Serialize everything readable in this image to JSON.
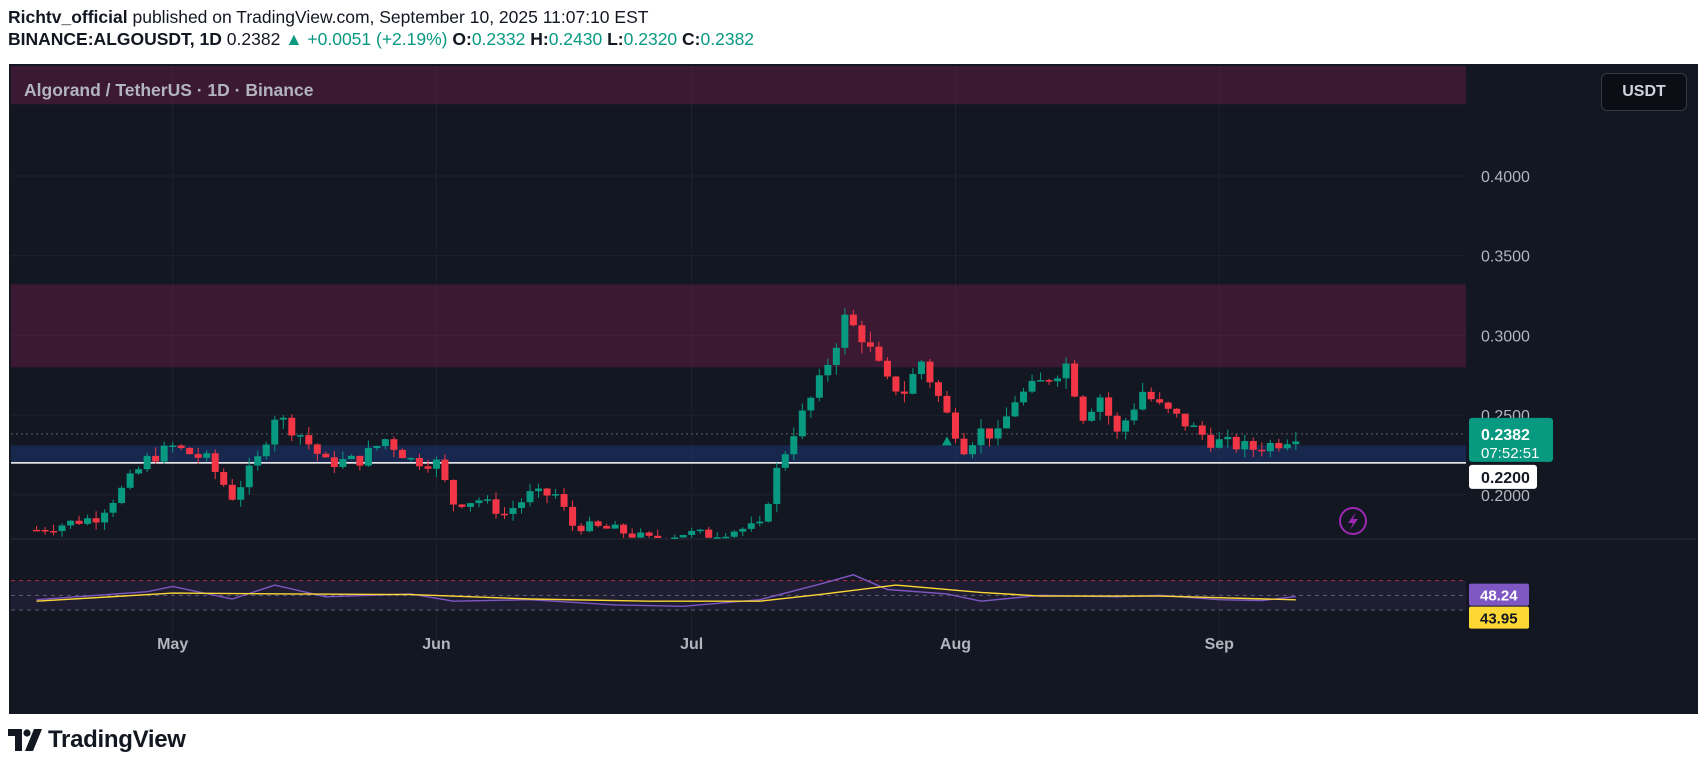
{
  "header": {
    "author": "Richtv_official",
    "published_text": " published on TradingView.com, September 10, 2025 11:07:10 EST",
    "symbol": "BINANCE:ALGOUSDT, 1D",
    "last": "0.2382",
    "change": "+0.0051 (+2.19%)",
    "o_label": "O:",
    "o": "0.2332",
    "h_label": "H:",
    "h": "0.2430",
    "l_label": "L:",
    "l": "0.2320",
    "c_label": "C:",
    "c": "0.2382"
  },
  "chart_header": {
    "title": "Algorand / TetherUS · 1D · Binance",
    "currency": "USDT"
  },
  "footer": {
    "brand": "TradingView"
  },
  "colors": {
    "up": "#089981",
    "down": "#f23645",
    "background": "#131722",
    "rsi_line": "#7e57c2",
    "rsi_ma": "#fdd835",
    "support_zone": "#1e3a8a",
    "resistance_zone": "#5b1f3c"
  },
  "chart_data": {
    "type": "candlestick",
    "title": "Algorand / TetherUS · 1D · Binance",
    "x_labels": [
      "May",
      "Jun",
      "Jul",
      "Aug",
      "Sep"
    ],
    "y_ticks": [
      "0.4000",
      "0.3500",
      "0.3000",
      "0.2500",
      "0.2000"
    ],
    "ylim": [
      0.17,
      0.45
    ],
    "current_price_label": "0.2382",
    "countdown_label": "07:52:51",
    "line_label": "0.2200",
    "zones": [
      {
        "type": "resistance",
        "from": 0.28,
        "to": 0.332
      },
      {
        "type": "resistance",
        "from": 0.445,
        "to": 0.47
      },
      {
        "type": "support",
        "from": 0.22,
        "to": 0.231
      }
    ],
    "horizontal_line": 0.22,
    "trend": [
      [
        "2025-04-15",
        0.178
      ],
      [
        "2025-04-22",
        0.186
      ],
      [
        "2025-04-25",
        0.203
      ],
      [
        "2025-04-28",
        0.222
      ],
      [
        "2025-05-01",
        0.23
      ],
      [
        "2025-05-05",
        0.222
      ],
      [
        "2025-05-08",
        0.199
      ],
      [
        "2025-05-11",
        0.222
      ],
      [
        "2025-05-13",
        0.25
      ],
      [
        "2025-05-16",
        0.238
      ],
      [
        "2025-05-19",
        0.22
      ],
      [
        "2025-05-23",
        0.222
      ],
      [
        "2025-05-26",
        0.235
      ],
      [
        "2025-05-29",
        0.222
      ],
      [
        "2025-06-01",
        0.22
      ],
      [
        "2025-06-03",
        0.195
      ],
      [
        "2025-06-06",
        0.197
      ],
      [
        "2025-06-09",
        0.188
      ],
      [
        "2025-06-12",
        0.2
      ],
      [
        "2025-06-15",
        0.2
      ],
      [
        "2025-06-17",
        0.181
      ],
      [
        "2025-06-22",
        0.178
      ],
      [
        "2025-06-26",
        0.172
      ],
      [
        "2025-06-30",
        0.176
      ],
      [
        "2025-07-03",
        0.175
      ],
      [
        "2025-07-06",
        0.178
      ],
      [
        "2025-07-09",
        0.18
      ],
      [
        "2025-07-11",
        0.215
      ],
      [
        "2025-07-13",
        0.24
      ],
      [
        "2025-07-16",
        0.27
      ],
      [
        "2025-07-19",
        0.31
      ],
      [
        "2025-07-21",
        0.3
      ],
      [
        "2025-07-24",
        0.27
      ],
      [
        "2025-07-26",
        0.265
      ],
      [
        "2025-07-28",
        0.284
      ],
      [
        "2025-07-31",
        0.25
      ],
      [
        "2025-08-02",
        0.23
      ],
      [
        "2025-08-04",
        0.24
      ],
      [
        "2025-08-06",
        0.237
      ],
      [
        "2025-08-08",
        0.26
      ],
      [
        "2025-08-11",
        0.27
      ],
      [
        "2025-08-14",
        0.282
      ],
      [
        "2025-08-16",
        0.25
      ],
      [
        "2025-08-18",
        0.262
      ],
      [
        "2025-08-20",
        0.238
      ],
      [
        "2025-08-23",
        0.265
      ],
      [
        "2025-08-25",
        0.255
      ],
      [
        "2025-08-28",
        0.245
      ],
      [
        "2025-08-31",
        0.234
      ],
      [
        "2025-09-02",
        0.232
      ],
      [
        "2025-09-05",
        0.229
      ],
      [
        "2025-09-08",
        0.233
      ],
      [
        "2025-09-10",
        0.2382
      ]
    ],
    "rsi": {
      "value_label": "48.24",
      "ma_label": "43.95",
      "upper": 70,
      "lower": 30,
      "trend": [
        [
          "2025-04-15",
          44
        ],
        [
          "2025-04-28",
          55
        ],
        [
          "2025-05-01",
          62
        ],
        [
          "2025-05-08",
          45
        ],
        [
          "2025-05-13",
          64
        ],
        [
          "2025-05-19",
          48
        ],
        [
          "2025-05-29",
          52
        ],
        [
          "2025-06-03",
          42
        ],
        [
          "2025-06-12",
          44
        ],
        [
          "2025-06-22",
          37
        ],
        [
          "2025-06-30",
          35
        ],
        [
          "2025-07-09",
          44
        ],
        [
          "2025-07-16",
          65
        ],
        [
          "2025-07-20",
          78
        ],
        [
          "2025-07-24",
          58
        ],
        [
          "2025-07-31",
          52
        ],
        [
          "2025-08-04",
          42
        ],
        [
          "2025-08-11",
          50
        ],
        [
          "2025-08-20",
          48
        ],
        [
          "2025-08-25",
          50
        ],
        [
          "2025-09-01",
          44
        ],
        [
          "2025-09-06",
          43
        ],
        [
          "2025-09-10",
          48.24
        ]
      ],
      "ma_trend": [
        [
          "2025-04-15",
          42
        ],
        [
          "2025-05-01",
          53
        ],
        [
          "2025-05-15",
          52
        ],
        [
          "2025-05-29",
          51
        ],
        [
          "2025-06-12",
          45
        ],
        [
          "2025-06-26",
          42
        ],
        [
          "2025-07-09",
          42
        ],
        [
          "2025-07-16",
          51
        ],
        [
          "2025-07-25",
          64
        ],
        [
          "2025-08-04",
          54
        ],
        [
          "2025-08-11",
          49
        ],
        [
          "2025-08-25",
          49
        ],
        [
          "2025-09-10",
          43.95
        ]
      ]
    }
  }
}
